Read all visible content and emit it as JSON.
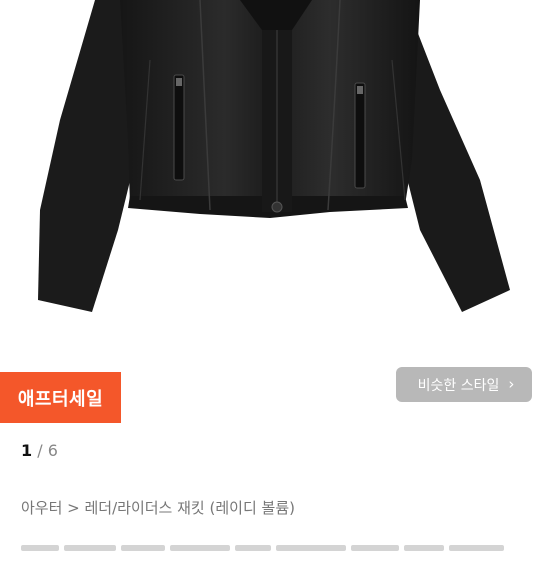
{
  "product": {
    "image_alt": "black leather rider jacket",
    "sale_badge": "애프터세일",
    "similar_style_button": "비슷한 스타일",
    "pager": {
      "current": "1",
      "separator": "/",
      "total": "6"
    },
    "breadcrumb": "아우터 > 레더/라이더스 재킷 (레이디 볼륨)"
  },
  "colors": {
    "badge_bg": "#f4572a",
    "similar_btn_bg": "#b8b8b8",
    "jacket": "#1f1f1f"
  },
  "icons": {
    "similar_chevron": "chevron-right-icon"
  }
}
